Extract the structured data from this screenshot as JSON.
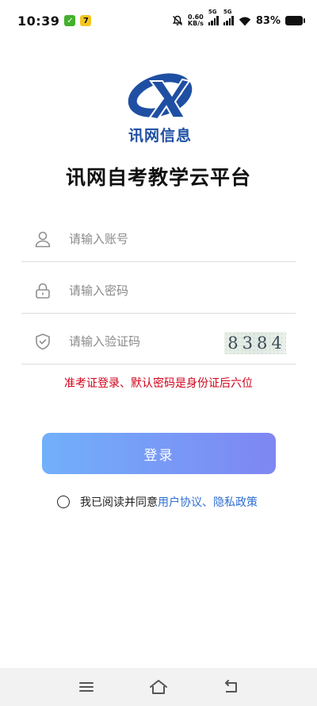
{
  "status_bar": {
    "time": "10:39",
    "net_speed_value": "0.60",
    "net_speed_unit": "KB/s",
    "signal1_tag": "5G",
    "signal2_tag": "5G",
    "battery": "83%"
  },
  "brand": {
    "name": "讯网信息",
    "logo_color": "#1f4fa3"
  },
  "title": "讯网自考教学云平台",
  "form": {
    "account_placeholder": "请输入账号",
    "password_placeholder": "请输入密码",
    "captcha_placeholder": "请输入验证码",
    "captcha_code": [
      "8",
      "3",
      "8",
      "4"
    ]
  },
  "hint": "准考证登录、默认密码是身份证后六位",
  "login_label": "登录",
  "agreement": {
    "prefix": "我已阅读并同意",
    "user_agreement": "用户协议",
    "separator": "、",
    "privacy_policy": "隐私政策"
  },
  "colors": {
    "accent_link": "#2f6fd1",
    "hint_red": "#d0021b",
    "button_start": "#71b0fa",
    "button_end": "#7f86f3"
  }
}
